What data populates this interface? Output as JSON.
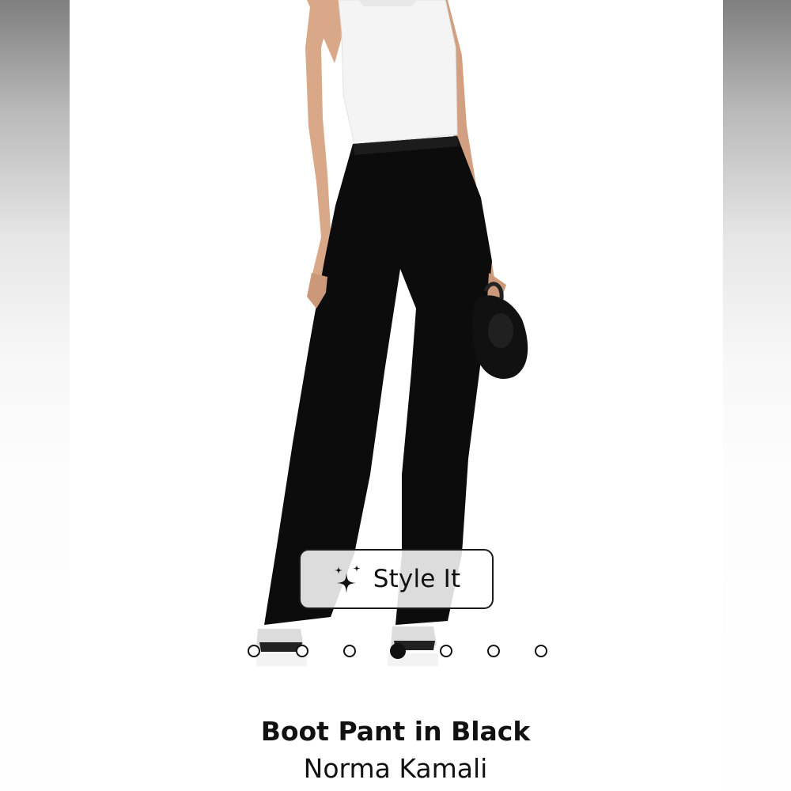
{
  "product": {
    "title": "Boot Pant in Black",
    "brand": "Norma Kamali"
  },
  "style_button": {
    "label": "Style It",
    "icon": "sparkle-icon"
  },
  "carousel": {
    "total": 7,
    "active_index": 3
  },
  "colors": {
    "text": "#111111",
    "pant": "#0c0c0c",
    "top": "#f4f4f4",
    "skin": "#d9a888"
  }
}
